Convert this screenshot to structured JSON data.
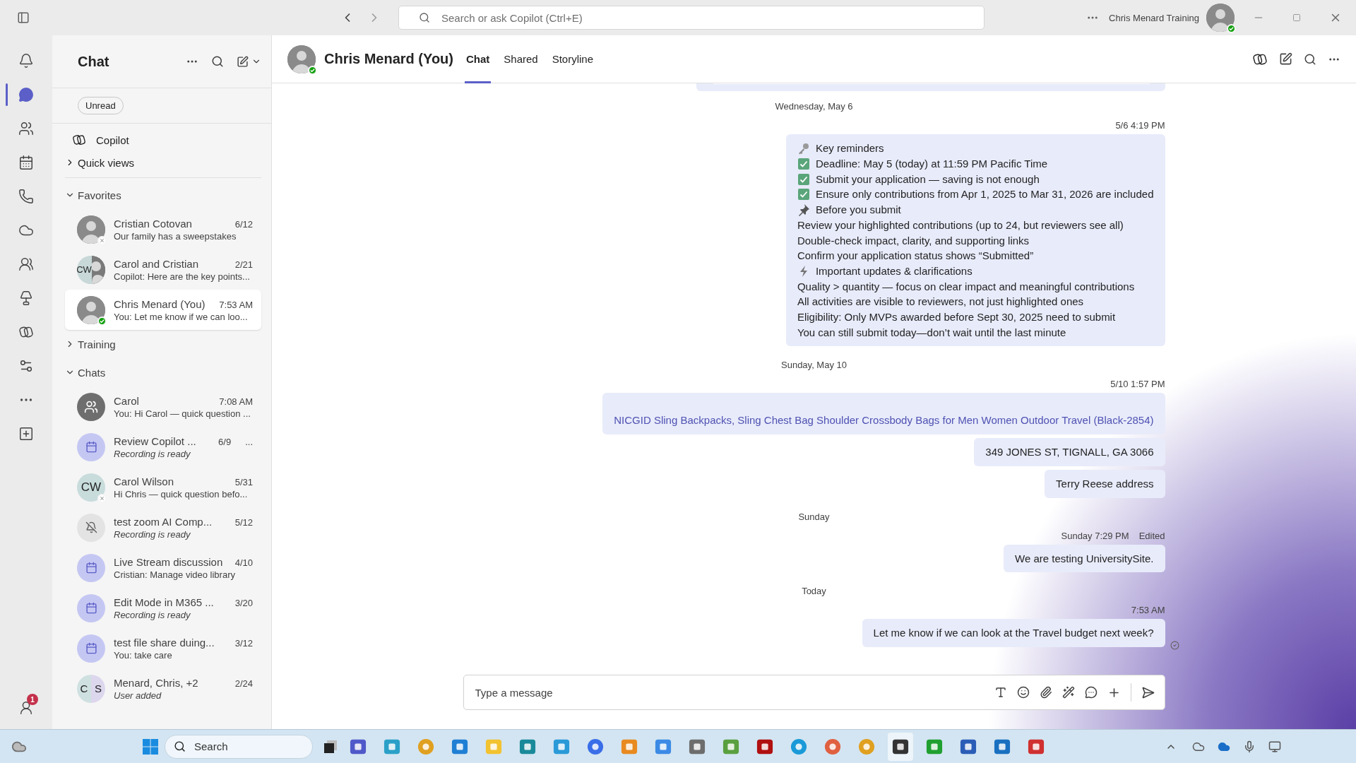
{
  "title_bar": {
    "search_placeholder": "Search or ask Copilot (Ctrl+E)",
    "account": "Chris Menard Training",
    "available": true
  },
  "rail": {
    "items": [
      {
        "selected": false
      },
      {
        "selected": true
      },
      {
        "selected": false
      },
      {
        "selected": false
      },
      {
        "selected": false
      },
      {
        "selected": false
      },
      {
        "selected": false
      },
      {
        "selected": false
      },
      {
        "selected": false
      },
      {
        "selected": false
      },
      {
        "selected": false
      },
      {
        "selected": false
      }
    ],
    "badge": "1"
  },
  "chat_list": {
    "title": "Chat",
    "filter": "Unread",
    "copilot": "Copilot",
    "quick_views": {
      "label": "Quick views",
      "expanded": false
    },
    "sections": [
      {
        "label": "Favorites",
        "expanded": true,
        "items": [
          {
            "name": "Cristian Cotovan",
            "time": "6/12",
            "preview": "Our family has a sweepstakes",
            "system": false,
            "selected": false,
            "avatar": {
              "kind": "photo"
            },
            "available": false
          },
          {
            "name": "Carol and Cristian",
            "time": "2/21",
            "preview": "Copilot: Here are the key points...",
            "system": false,
            "selected": false,
            "avatar": {
              "kind": "split",
              "initials": "CW"
            }
          },
          {
            "name": "Chris Menard (You)",
            "time": "7:53 AM",
            "preview": "You: Let me know if we can loo...",
            "system": false,
            "selected": true,
            "avatar": {
              "kind": "photo"
            },
            "available": true
          }
        ]
      },
      {
        "label": "Training",
        "expanded": false
      },
      {
        "label": "Chats",
        "expanded": true,
        "items": [
          {
            "name": "Carol",
            "time": "7:08 AM",
            "preview": "You: Hi Carol — quick question ...",
            "system": false,
            "selected": false,
            "avatar": {
              "kind": "group"
            }
          },
          {
            "name": "Review Copilot ...",
            "time": "6/9",
            "preview": "Recording is ready",
            "system": true,
            "selected": false,
            "hover_more": "...",
            "avatar": {
              "kind": "meeting"
            }
          },
          {
            "name": "Carol Wilson",
            "time": "5/31",
            "preview": "Hi Chris — quick question befo...",
            "system": false,
            "selected": false,
            "avatar": {
              "kind": "initials",
              "initials": "CW"
            },
            "available": false
          },
          {
            "name": "test zoom AI Comp...",
            "time": "5/12",
            "preview": "Recording is ready",
            "system": true,
            "selected": false,
            "avatar": {
              "kind": "muted"
            }
          },
          {
            "name": "Live Stream discussion",
            "time": "4/10",
            "preview": "Cristian: Manage video library",
            "system": false,
            "selected": false,
            "avatar": {
              "kind": "meeting"
            }
          },
          {
            "name": "Edit Mode in M365 ...",
            "time": "3/20",
            "preview": "Recording is ready",
            "system": true,
            "selected": false,
            "avatar": {
              "kind": "meeting"
            }
          },
          {
            "name": "test file share duing...",
            "time": "3/12",
            "preview": "You: take care",
            "system": false,
            "selected": false,
            "avatar": {
              "kind": "meeting"
            }
          },
          {
            "name": "Menard, Chris, +2",
            "time": "2/24",
            "preview": "User added",
            "system": true,
            "selected": false,
            "avatar": {
              "kind": "pair",
              "initials": [
                "C",
                "S"
              ]
            }
          }
        ]
      }
    ]
  },
  "chat_header": {
    "name": "Chris Menard (You)",
    "available": true,
    "tabs": [
      {
        "label": "Chat",
        "selected": true
      },
      {
        "label": "Shared",
        "selected": false
      },
      {
        "label": "Storyline",
        "selected": false
      }
    ]
  },
  "messages": [
    {
      "kind": "card"
    },
    {
      "kind": "divider",
      "text": "Wednesday, May 6"
    },
    {
      "kind": "group",
      "time": "5/6 4:19 PM",
      "bubbles": [
        {
          "link": false,
          "lines": [
            {
              "kind": "key",
              "text": "Key reminders"
            },
            {
              "kind": "check",
              "text": "Deadline: May 5 (today) at 11:59 PM Pacific Time"
            },
            {
              "kind": "check",
              "text": "Submit your application — saving is not enough"
            },
            {
              "kind": "check",
              "text": "Ensure only contributions from Apr 1, 2025 to Mar 31, 2026 are included"
            },
            {
              "kind": "pin",
              "text": "Before you submit"
            },
            {
              "kind": "plain",
              "text": "Review your highlighted contributions (up to 24, but reviewers see all)"
            },
            {
              "kind": "plain",
              "text": "Double-check impact, clarity, and supporting links"
            },
            {
              "kind": "plain",
              "text": "Confirm your application status shows “Submitted”"
            },
            {
              "kind": "bolt",
              "text": "Important updates & clarifications"
            },
            {
              "kind": "plain",
              "text": "Quality > quantity — focus on clear impact and meaningful contributions"
            },
            {
              "kind": "plain",
              "text": "All activities are visible to reviewers, not just highlighted ones"
            },
            {
              "kind": "plain",
              "text": "Eligibility: Only MVPs awarded before Sept 30, 2025 need to submit"
            },
            {
              "kind": "plain",
              "text": "You can still submit today—don’t wait until the last minute"
            }
          ]
        }
      ]
    },
    {
      "kind": "divider",
      "text": "Sunday, May 10"
    },
    {
      "kind": "group",
      "time": "5/10 1:57 PM",
      "bubbles": [
        {
          "link": true,
          "lines": [
            {
              "text": "NICGID Sling Backpacks, Sling Chest Bag Shoulder Crossbody Bags for Men Women Outdoor Travel (Black-2854)"
            }
          ]
        },
        {
          "link": false,
          "lines": [
            {
              "kind": "plain",
              "text": "349 JONES ST, TIGNALL, GA 3066"
            }
          ]
        },
        {
          "link": false,
          "lines": [
            {
              "kind": "plain",
              "text": "Terry Reese address"
            }
          ]
        }
      ]
    },
    {
      "kind": "divider",
      "text": "Sunday"
    },
    {
      "kind": "group",
      "time": "Sunday 7:29 PM",
      "edited": "Edited",
      "bubbles": [
        {
          "link": false,
          "lines": [
            {
              "kind": "plain",
              "text": "We are testing UniversitySite."
            }
          ]
        }
      ]
    },
    {
      "kind": "divider",
      "text": "Today"
    },
    {
      "kind": "group",
      "time": "7:53 AM",
      "seen": true,
      "bubbles": [
        {
          "link": false,
          "lines": [
            {
              "kind": "plain",
              "text": "Let me know if we can look at the Travel budget next week?"
            }
          ]
        }
      ]
    }
  ],
  "composer": {
    "placeholder": "Type a message"
  },
  "taskbar": {
    "search_placeholder": "Search"
  }
}
